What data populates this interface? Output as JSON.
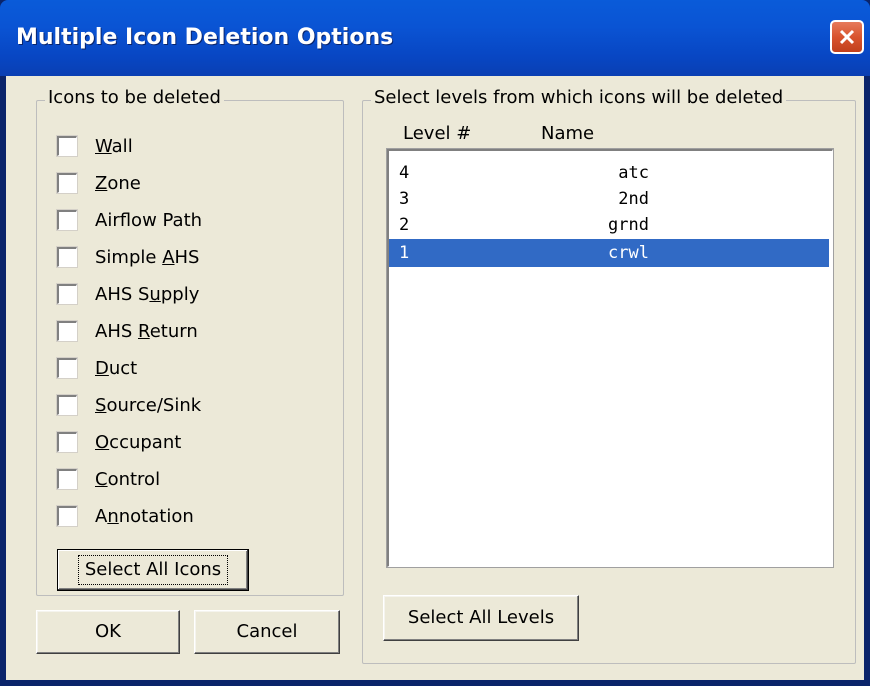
{
  "window": {
    "title": "Multiple Icon Deletion Options",
    "close_icon": "close-icon"
  },
  "icons_group": {
    "label": "Icons to be deleted",
    "items": [
      {
        "label": "Wall",
        "mnemonic": "W",
        "checked": false
      },
      {
        "label": "Zone",
        "mnemonic": "Z",
        "checked": false
      },
      {
        "label": "Airflow Path",
        "mnemonic": "",
        "checked": false
      },
      {
        "label": "Simple AHS",
        "mnemonic": "A",
        "checked": false
      },
      {
        "label": "AHS Supply",
        "mnemonic": "u",
        "checked": false
      },
      {
        "label": "AHS Return",
        "mnemonic": "R",
        "checked": false
      },
      {
        "label": "Duct",
        "mnemonic": "D",
        "checked": false
      },
      {
        "label": "Source/Sink",
        "mnemonic": "S",
        "checked": false
      },
      {
        "label": "Occupant",
        "mnemonic": "O",
        "checked": false
      },
      {
        "label": "Control",
        "mnemonic": "C",
        "checked": false
      },
      {
        "label": "Annotation",
        "mnemonic": "n",
        "checked": false
      }
    ],
    "select_all_label": "Select All Icons"
  },
  "levels_group": {
    "label": "Select levels from which icons will be deleted",
    "columns": {
      "level": "Level #",
      "name": "Name"
    },
    "rows": [
      {
        "level": "4",
        "name": "atc",
        "selected": false
      },
      {
        "level": "3",
        "name": "2nd",
        "selected": false
      },
      {
        "level": "2",
        "name": "grnd",
        "selected": false
      },
      {
        "level": "1",
        "name": "crwl",
        "selected": true
      }
    ],
    "select_all_label": "Select All Levels"
  },
  "buttons": {
    "ok": "OK",
    "cancel": "Cancel"
  },
  "colors": {
    "titlebar": "#0a54d4",
    "selection": "#316ac5",
    "face": "#ece9d8",
    "close": "#d9542e"
  }
}
